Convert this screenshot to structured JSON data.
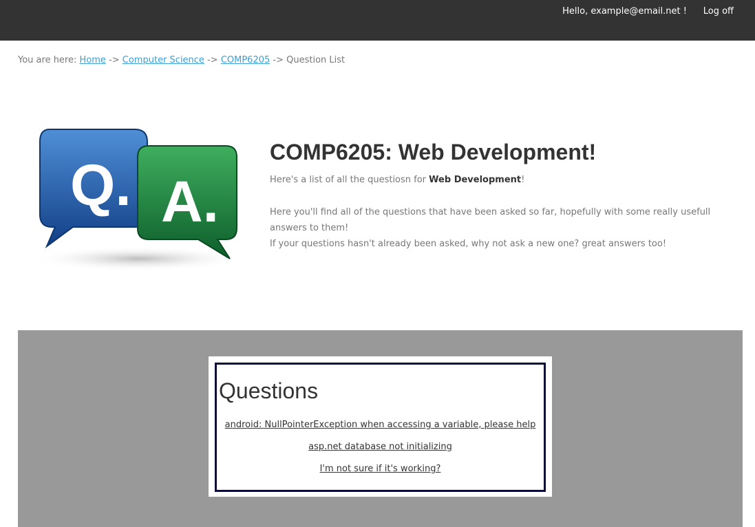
{
  "header": {
    "greeting": "Hello, example@email.net !",
    "logoff_label": "Log off"
  },
  "breadcrumb": {
    "prefix": "You are here:",
    "links": [
      "Home",
      "Computer Science",
      "COMP6205"
    ],
    "separator": "->",
    "current": "Question List"
  },
  "logo": {
    "q_letter": "Q.",
    "a_letter": "A.",
    "q_color": "#1f5aa0",
    "a_color": "#1f8a44"
  },
  "hero": {
    "title": "COMP6205: Web Development!",
    "intro_prefix": "Here's a list of all the questiosn for ",
    "intro_bold": "Web Development",
    "intro_suffix": "!",
    "body_line1": "Here you'll find all of the questions that have been asked so far, hopefully with some really usefull answers to them!",
    "body_line2": "If your questions hasn't already been asked, why not ask a new one? great answers too!"
  },
  "questions": {
    "title": "Questions",
    "items": [
      "android: NullPointerException when accessing a variable, please help",
      "asp.net database not initializing",
      "I'm not sure if it's working?"
    ]
  }
}
